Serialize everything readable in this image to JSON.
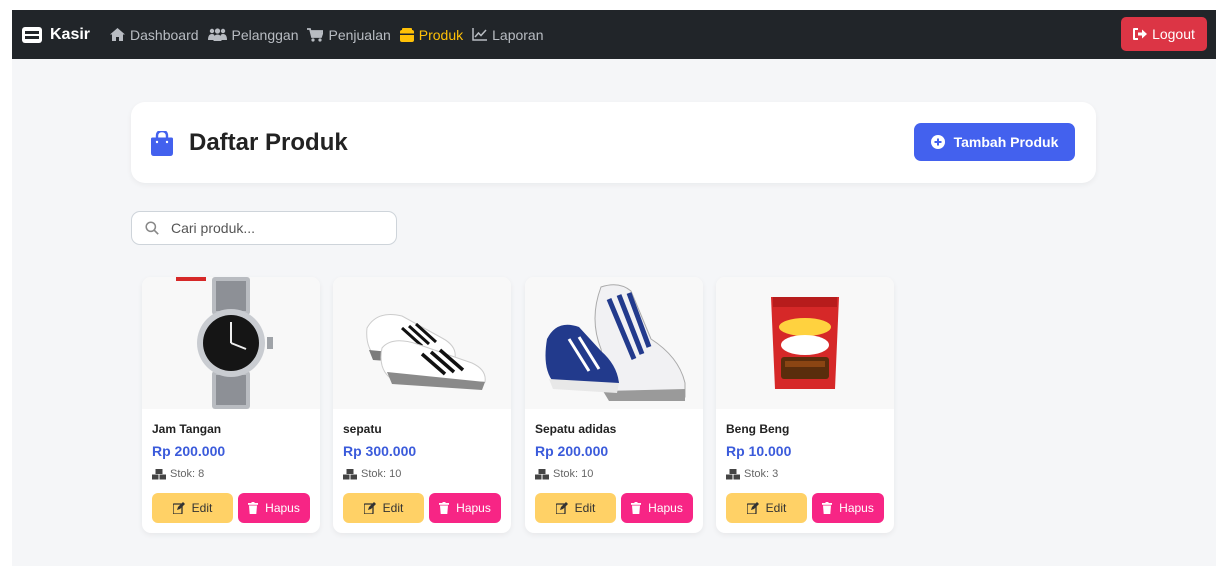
{
  "navbar": {
    "brand": "Kasir",
    "items": [
      {
        "label": "Dashboard"
      },
      {
        "label": "Pelanggan"
      },
      {
        "label": "Penjualan"
      },
      {
        "label": "Produk"
      },
      {
        "label": "Laporan"
      }
    ],
    "logout_label": "Logout",
    "active_color": "#ffc107"
  },
  "header": {
    "title": "Daftar Produk",
    "add_button_label": "Tambah Produk",
    "accent_color": "#4361ee"
  },
  "search": {
    "placeholder": "Cari produk...",
    "value": ""
  },
  "products": [
    {
      "name": "Jam Tangan",
      "price": "Rp 200.000",
      "stock": "Stok: 8",
      "edit_label": "Edit",
      "delete_label": "Hapus",
      "image": "watch"
    },
    {
      "name": "sepatu",
      "price": "Rp 300.000",
      "stock": "Stok: 10",
      "edit_label": "Edit",
      "delete_label": "Hapus",
      "image": "sneakers"
    },
    {
      "name": "Sepatu adidas",
      "price": "Rp 200.000",
      "stock": "Stok: 10",
      "edit_label": "Edit",
      "delete_label": "Hapus",
      "image": "running-shoes"
    },
    {
      "name": "Beng Beng",
      "price": "Rp 10.000",
      "stock": "Stok: 3",
      "edit_label": "Edit",
      "delete_label": "Hapus",
      "image": "snack-pack"
    }
  ]
}
